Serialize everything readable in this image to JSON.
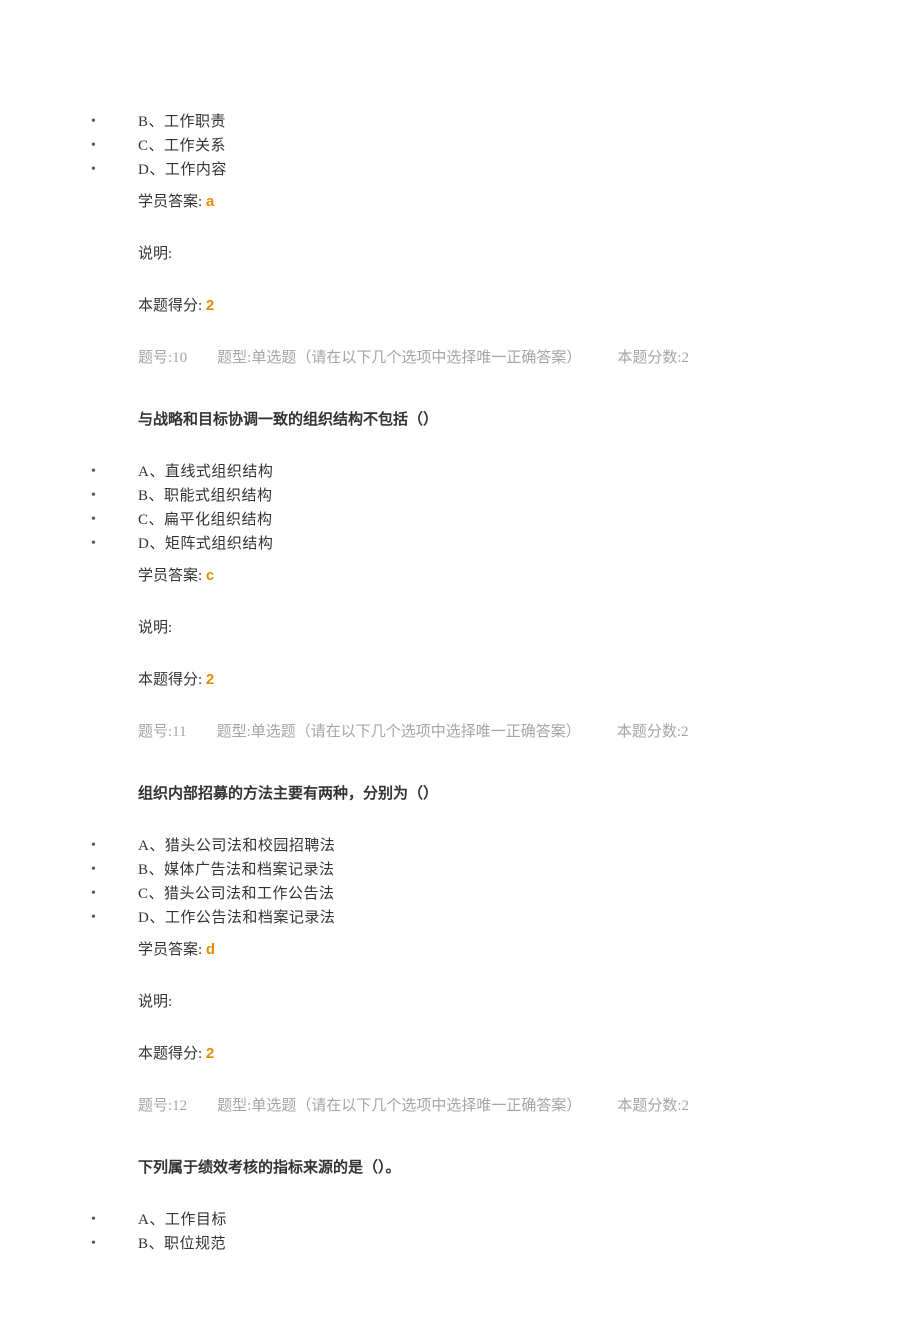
{
  "labels": {
    "studentAnswer": "学员答案:",
    "explanation": "说明:",
    "score": "本题得分:",
    "qnoPrefix": "题号:",
    "typePrefix": "题型:",
    "typeFull": "单选题（请在以下几个选项中选择唯一正确答案）",
    "ptsPrefix": "本题分数:"
  },
  "q9": {
    "options": {
      "B": "B、工作职责",
      "C": "C、工作关系",
      "D": "D、工作内容"
    },
    "answer": "a",
    "score": "2"
  },
  "q10": {
    "qno": "10",
    "pts": "2",
    "stem": "与战略和目标协调一致的组织结构不包括（）",
    "options": {
      "A": "A、直线式组织结构",
      "B": "B、职能式组织结构",
      "C": "C、扁平化组织结构",
      "D": "D、矩阵式组织结构"
    },
    "answer": "c",
    "score": "2"
  },
  "q11": {
    "qno": "11",
    "pts": "2",
    "stem": "组织内部招募的方法主要有两种，分别为（）",
    "options": {
      "A": "A、猎头公司法和校园招聘法",
      "B": "B、媒体广告法和档案记录法",
      "C": "C、猎头公司法和工作公告法",
      "D": "D、工作公告法和档案记录法"
    },
    "answer": "d",
    "score": "2"
  },
  "q12": {
    "qno": "12",
    "pts": "2",
    "stem": "下列属于绩效考核的指标来源的是（）。",
    "options": {
      "A": "A、工作目标",
      "B": "B、职位规范"
    }
  }
}
